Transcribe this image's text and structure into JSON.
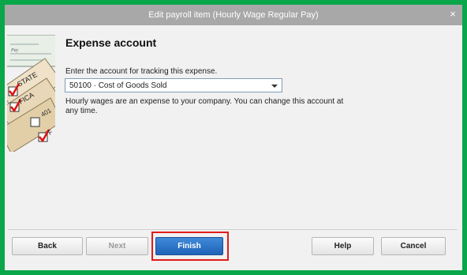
{
  "window": {
    "title": "Edit payroll item (Hourly Wage Regular Pay)",
    "close_glyph": "×"
  },
  "illustration": {
    "icon": "payroll-checklist-illustration",
    "labels": [
      "Pay",
      "STATE",
      "FICA",
      "401",
      "F"
    ]
  },
  "content": {
    "heading": "Expense account",
    "prompt": "Enter the account for tracking this expense.",
    "account_select": {
      "value": "50100 · Cost of Goods Sold"
    },
    "note": "Hourly wages are an expense to your company. You can change this account at any time."
  },
  "buttons": {
    "back": "Back",
    "next": "Next",
    "finish": "Finish",
    "help": "Help",
    "cancel": "Cancel"
  },
  "colors": {
    "frame": "#0aa64a",
    "titlebar": "#a8a8a8",
    "primary_button": "#2a72c8",
    "highlight": "#e11b1b"
  }
}
